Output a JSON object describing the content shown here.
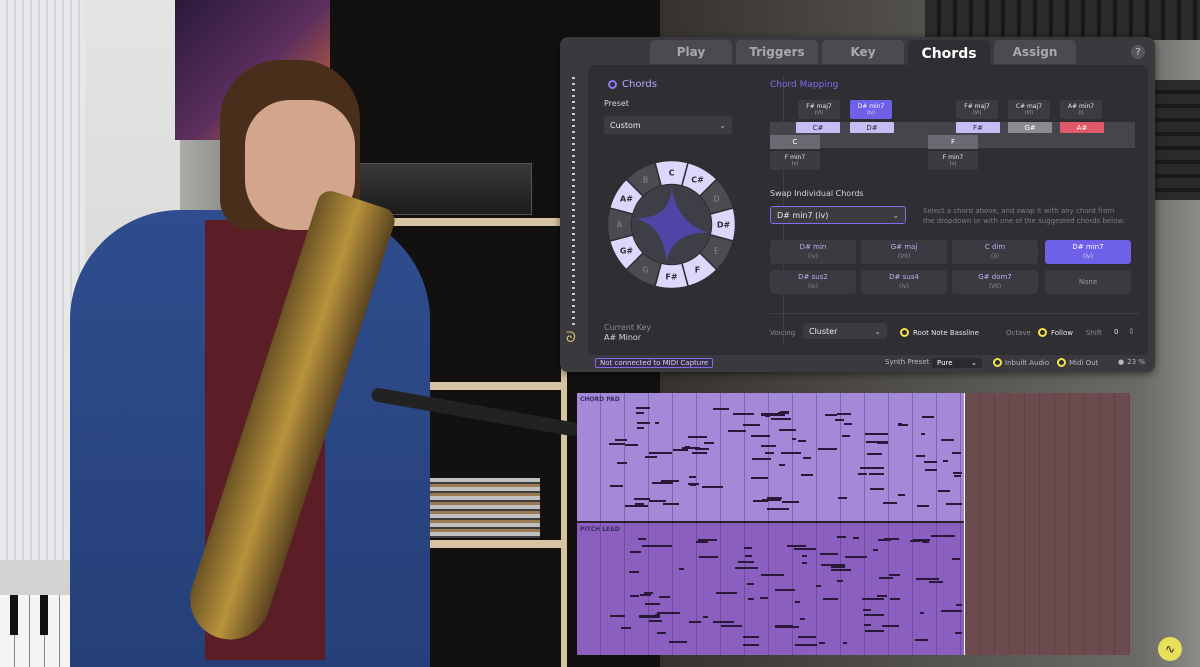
{
  "tabs": [
    {
      "label": "Play"
    },
    {
      "label": "Triggers"
    },
    {
      "label": "Key"
    },
    {
      "label": "Chords"
    },
    {
      "label": "Assign"
    }
  ],
  "help_label": "?",
  "left": {
    "chords_label": "Chords",
    "preset_label": "Preset",
    "preset_value": "Custom",
    "current_key_label": "Current Key",
    "current_key_value": "A# Minor",
    "wheel_notes": [
      "C",
      "C#",
      "D",
      "D#",
      "E",
      "F",
      "F#",
      "G",
      "G#",
      "A",
      "A#",
      "B"
    ],
    "wheel_active": [
      "C",
      "C#",
      "D#",
      "F",
      "F#",
      "G#",
      "A#"
    ]
  },
  "mapping": {
    "title": "Chord Mapping",
    "top_chords_a": [
      {
        "name": "F# maj7",
        "deg": "(VI)"
      },
      {
        "name": "D# min7",
        "deg": "(iv)"
      }
    ],
    "top_chords_b": [
      {
        "name": "F# maj7",
        "deg": "(VI)"
      },
      {
        "name": "C# maj7",
        "deg": "(III)"
      },
      {
        "name": "A# min7",
        "deg": "(i)"
      }
    ],
    "keys_a": [
      "C#",
      "D#"
    ],
    "keys_b": [
      "F#",
      "G#",
      "A#"
    ],
    "white_a": "C",
    "white_b": "F",
    "bottom_a": {
      "name": "F min7",
      "deg": "(v)"
    },
    "bottom_b": {
      "name": "F min7",
      "deg": "(v)"
    }
  },
  "swap": {
    "title": "Swap Individual Chords",
    "selected": "D# min7 (iv)",
    "help": "Select a chord above, and swap it with any chord from the dropdown or with one of the suggested chords below.",
    "suggestions": [
      {
        "name": "D# min",
        "deg": "(iv)"
      },
      {
        "name": "G# maj",
        "deg": "(VII)"
      },
      {
        "name": "C dim",
        "deg": "(ii)"
      },
      {
        "name": "D# min7",
        "deg": "(iv)"
      },
      {
        "name": "D# sus2",
        "deg": "(iv)"
      },
      {
        "name": "D# sus4",
        "deg": "(iv)"
      },
      {
        "name": "G# dom7",
        "deg": "(VII)"
      },
      {
        "name": "None",
        "deg": ""
      }
    ]
  },
  "footer": {
    "voicing_label": "Voicing",
    "voicing_value": "Cluster",
    "root_bassline": "Root Note Bassline",
    "octave_label": "Octave",
    "follow_label": "Follow",
    "shift_label": "Shift",
    "shift_value": "0"
  },
  "status": {
    "midi": "Not connected to MIDI Capture",
    "synth_label": "Synth Preset",
    "synth_value": "Pure",
    "inbuilt": "Inbuilt Audio",
    "midi_out": "Midi Out",
    "percent": "23 %"
  },
  "roll": {
    "track1": "CHORD PAD",
    "track2": "PITCH LEAD"
  },
  "colors": {
    "accent": "#6e60e8",
    "highlight_red": "#e0596b",
    "pad": "#a389d7",
    "lead": "#8a5fc0"
  }
}
